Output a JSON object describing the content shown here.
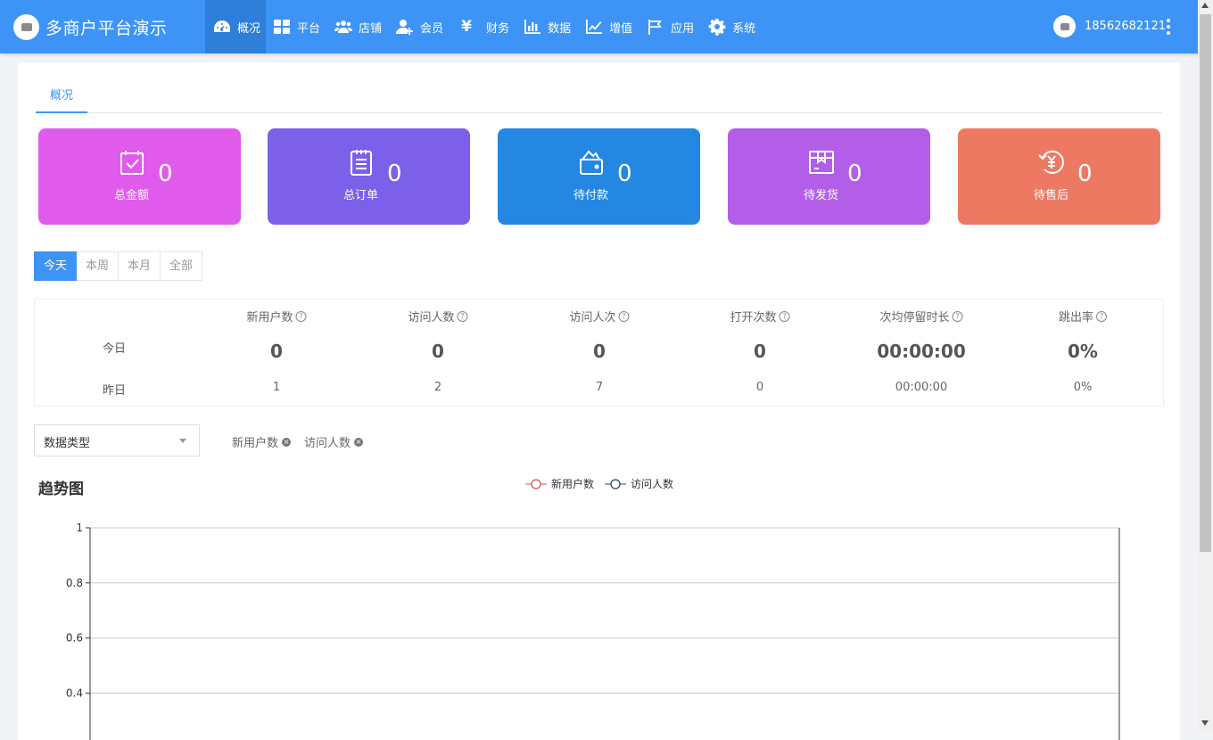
{
  "header": {
    "title": "多商户平台演示",
    "nav": [
      {
        "label": "概况",
        "icon": "dashboard-icon",
        "active": true
      },
      {
        "label": "平台",
        "icon": "grid-icon"
      },
      {
        "label": "店铺",
        "icon": "users-icon"
      },
      {
        "label": "会员",
        "icon": "user-add-icon"
      },
      {
        "label": "财务",
        "icon": "yen-icon",
        "glyph": "¥"
      },
      {
        "label": "数据",
        "icon": "bar-chart-icon"
      },
      {
        "label": "增值",
        "icon": "line-chart-icon"
      },
      {
        "label": "应用",
        "icon": "flag-icon"
      },
      {
        "label": "系统",
        "icon": "gear-icon"
      }
    ],
    "user_phone": "18562682121"
  },
  "tab": "概况",
  "cards": [
    {
      "label": "总金额",
      "value": "0",
      "color": "#e05bec",
      "icon": "checklist-icon"
    },
    {
      "label": "总订单",
      "value": "0",
      "color": "#7c60e9",
      "icon": "document-icon"
    },
    {
      "label": "待付款",
      "value": "0",
      "color": "#2488e2",
      "icon": "wallet-icon"
    },
    {
      "label": "待发货",
      "value": "0",
      "color": "#b25ee9",
      "icon": "box-icon"
    },
    {
      "label": "待售后",
      "value": "0",
      "color": "#ee7963",
      "icon": "refund-icon"
    }
  ],
  "periods": [
    "今天",
    "本周",
    "本月",
    "全部"
  ],
  "stats": {
    "headers": [
      "新用户数",
      "访问人数",
      "访问人次",
      "打开次数",
      "次均停留时长",
      "跳出率"
    ],
    "today_label": "今日",
    "yesterday_label": "昨日",
    "today": [
      "0",
      "0",
      "0",
      "0",
      "00:00:00",
      "0%"
    ],
    "yesterday": [
      "1",
      "2",
      "7",
      "0",
      "00:00:00",
      "0%"
    ]
  },
  "filter": {
    "select_label": "数据类型",
    "chips": [
      "新用户数",
      "访问人数"
    ]
  },
  "chart_data": {
    "type": "line",
    "title": "趋势图",
    "series": [
      {
        "name": "新用户数",
        "color": "#d9534f",
        "values": []
      },
      {
        "name": "访问人数",
        "color": "#2f4554",
        "values": []
      }
    ],
    "yticks": [
      "1",
      "0.8",
      "0.6",
      "0.4"
    ],
    "ylim": [
      0,
      1
    ],
    "legend": "top-center",
    "grid": true
  }
}
